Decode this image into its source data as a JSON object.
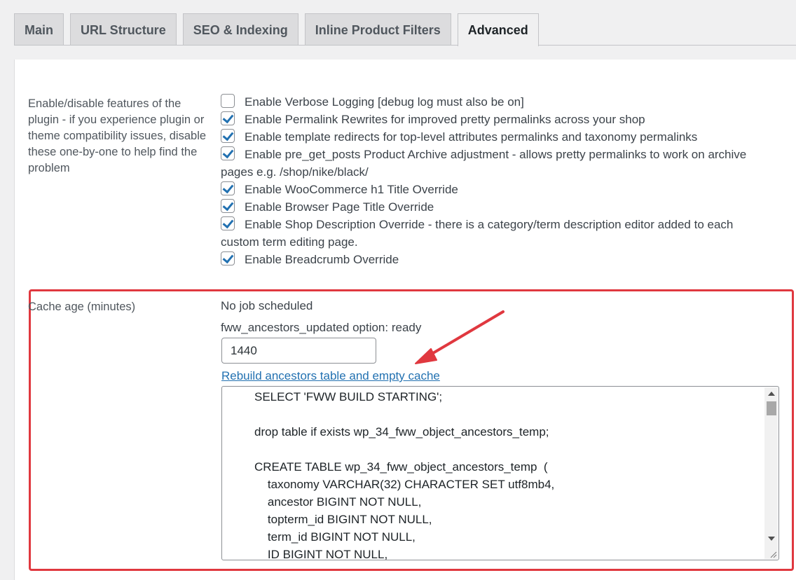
{
  "tabs": [
    {
      "label": "Main",
      "active": false
    },
    {
      "label": "URL Structure",
      "active": false
    },
    {
      "label": "SEO & Indexing",
      "active": false
    },
    {
      "label": "Inline Product Filters",
      "active": false
    },
    {
      "label": "Advanced",
      "active": true
    }
  ],
  "features": {
    "description": "Enable/disable features of the plugin - if you experience plugin or theme compatibility issues, disable these one-by-one to help find the problem",
    "options": [
      {
        "label": "Enable Verbose Logging [debug log must also be on]",
        "checked": false
      },
      {
        "label": "Enable Permalink Rewrites for improved pretty permalinks across your shop",
        "checked": true
      },
      {
        "label": "Enable template redirects for top-level attributes permalinks and taxonomy permalinks",
        "checked": true
      },
      {
        "label": "Enable pre_get_posts Product Archive adjustment - allows pretty permalinks to work on archive pages e.g. /shop/nike/black/",
        "checked": true
      },
      {
        "label": "Enable WooCommerce h1 Title Override",
        "checked": true
      },
      {
        "label": "Enable Browser Page Title Override",
        "checked": true
      },
      {
        "label": "Enable Shop Description Override - there is a category/term description editor added to each custom term editing page.",
        "checked": true
      },
      {
        "label": "Enable Breadcrumb Override",
        "checked": true
      }
    ]
  },
  "cache": {
    "label": "Cache age (minutes)",
    "job_status": "No job scheduled",
    "option_status": "fww_ancestors_updated option: ready",
    "value": "1440",
    "rebuild_link": "Rebuild ancestors table and empty cache",
    "sql_lines": [
      "SELECT 'FWW BUILD STARTING';",
      "",
      "drop table if exists wp_34_fww_object_ancestors_temp;",
      "",
      "CREATE TABLE wp_34_fww_object_ancestors_temp  (",
      "    taxonomy VARCHAR(32) CHARACTER SET utf8mb4,",
      "    ancestor BIGINT NOT NULL,",
      "    topterm_id BIGINT NOT NULL,",
      "    term_id BIGINT NOT NULL,",
      "    ID BIGINT NOT NULL,"
    ]
  },
  "colors": {
    "highlight": "#e0383f",
    "link": "#2271b1",
    "checkbox": "#2271b1"
  }
}
